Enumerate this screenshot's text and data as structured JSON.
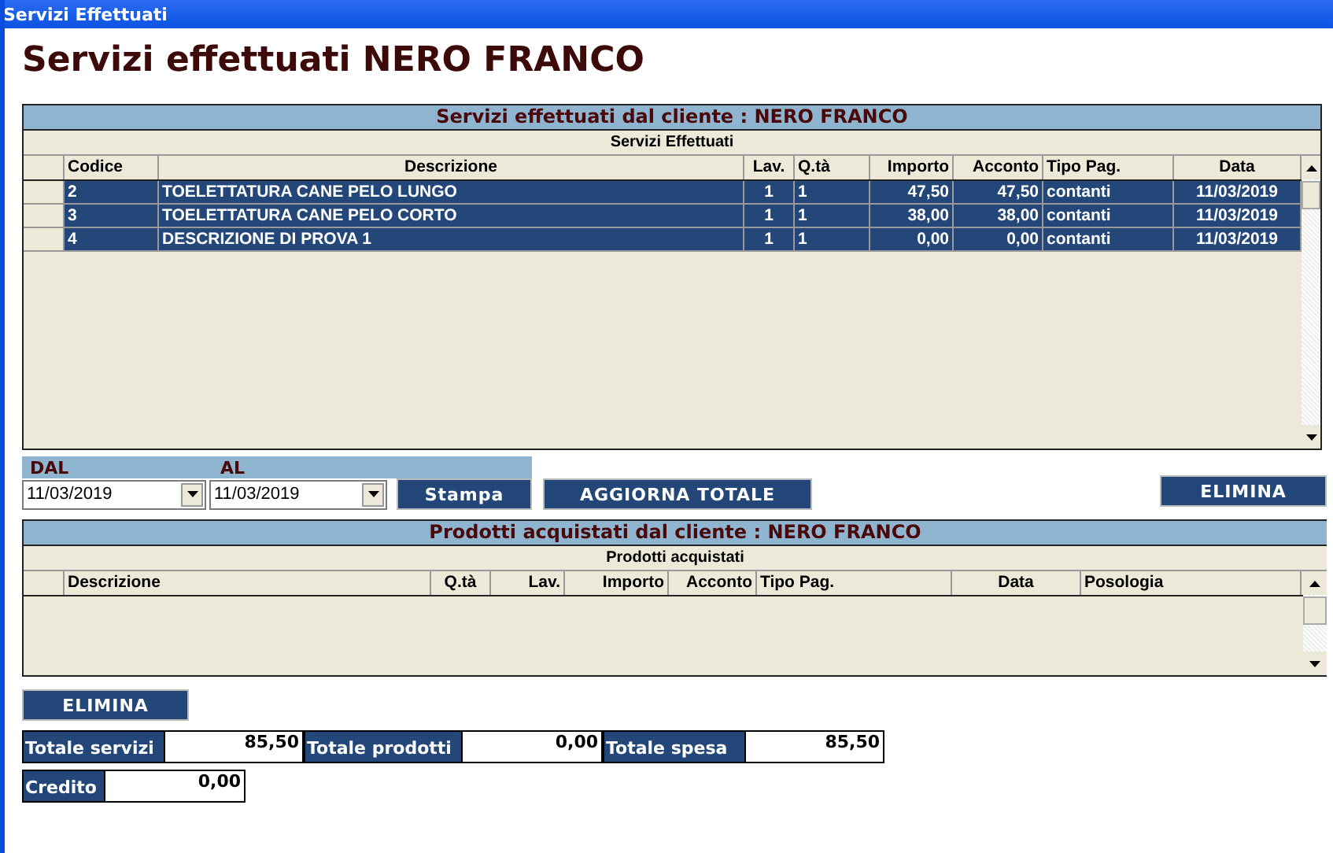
{
  "window": {
    "title": "Servizi Effettuati"
  },
  "heading": "Servizi effettuati NERO FRANCO",
  "services": {
    "title": "Servizi effettuati dal cliente : NERO FRANCO",
    "subtitle": "Servizi Effettuati",
    "columns": [
      "Codice",
      "Descrizione",
      "Lav.",
      "Q.tà",
      "Importo",
      "Acconto",
      "Tipo Pag.",
      "Data"
    ],
    "rows": [
      {
        "selected": true,
        "cells": [
          "2",
          "TOELETTATURA CANE PELO LUNGO",
          "1",
          "1",
          "47,50",
          "47,50",
          "contanti",
          "11/03/2019"
        ]
      },
      {
        "selected": true,
        "cells": [
          "3",
          "TOELETTATURA CANE PELO CORTO",
          "1",
          "1",
          "38,00",
          "38,00",
          "contanti",
          "11/03/2019"
        ]
      },
      {
        "selected": true,
        "cells": [
          "4",
          "DESCRIZIONE DI PROVA 1",
          "1",
          "1",
          "0,00",
          "0,00",
          "contanti",
          "11/03/2019"
        ]
      }
    ]
  },
  "filter": {
    "from_label": "DAL",
    "to_label": "AL",
    "from": "11/03/2019",
    "to": "11/03/2019"
  },
  "buttons": {
    "print": "Stampa",
    "refresh": "AGGIORNA TOTALE",
    "delete_services": "ELIMINA",
    "delete_products": "ELIMINA"
  },
  "products": {
    "title": "Prodotti acquistati dal cliente : NERO FRANCO",
    "subtitle": "Prodotti acquistati",
    "columns": [
      "Descrizione",
      "Q.tà",
      "Lav.",
      "Importo",
      "Acconto",
      "Tipo Pag.",
      "Data",
      "Posologia"
    ]
  },
  "totals": [
    {
      "label": "Totale servizi",
      "value": "85,50"
    },
    {
      "label": "Totale prodotti",
      "value": "0,00"
    },
    {
      "label": "Totale spesa",
      "value": "85,50"
    }
  ],
  "credit": {
    "label": "Credito",
    "value": "0,00"
  }
}
